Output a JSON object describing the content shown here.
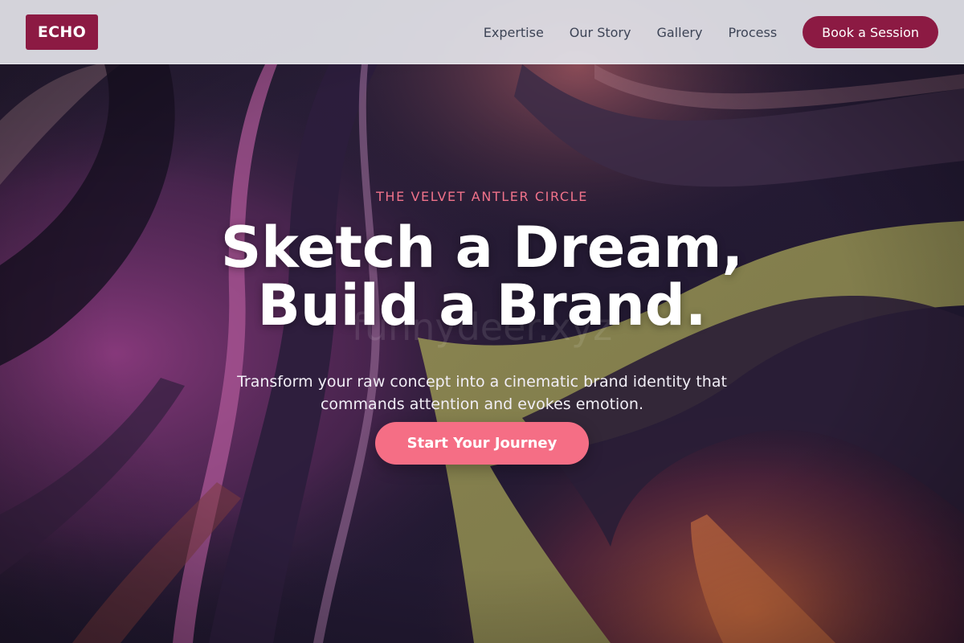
{
  "brand": {
    "logo_text": "ECHO",
    "accent_color": "#8c1a43",
    "highlight_color": "#f56e85"
  },
  "nav": {
    "links": [
      "Expertise",
      "Our Story",
      "Gallery",
      "Process"
    ],
    "cta_label": "Book a Session"
  },
  "hero": {
    "eyebrow": "THE VELVET ANTLER CIRCLE",
    "headline_line1": "Sketch a Dream,",
    "headline_line2": "Build a Brand.",
    "watermark": "funnydeer.xyz",
    "subhead": "Transform your raw concept into a cinematic brand identity that commands attention and evokes emotion.",
    "cta_label": "Start Your Journey",
    "background": "abstract-swirl-artwork"
  }
}
